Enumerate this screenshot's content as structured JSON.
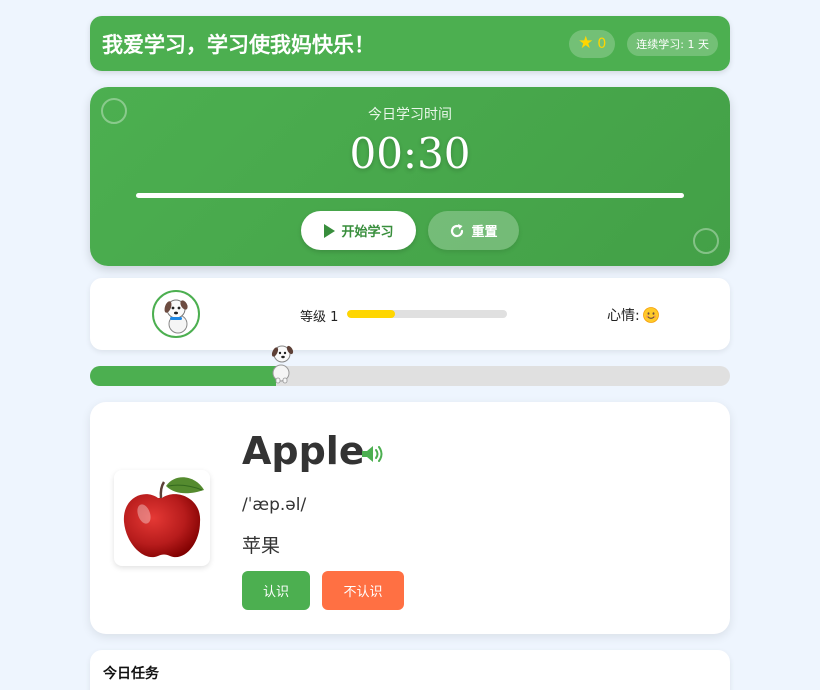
{
  "header": {
    "title": "我爱学习，学习使我妈快乐！",
    "stars": "0",
    "streak": "连续学习: 1 天"
  },
  "timer": {
    "label": "今日学习时间",
    "value": "00:30",
    "start_label": "开始学习",
    "reset_label": "重置",
    "bar_fraction": 1.0
  },
  "status": {
    "level_label": "等级 1",
    "level_progress": 0.3,
    "mood_label": "心情:",
    "mood_icon": "smile-face-icon"
  },
  "study_progress": 0.29,
  "word_card": {
    "word": "Apple",
    "phonetic": "/ˈæp.əl/",
    "meaning": "苹果",
    "know_label": "认识",
    "unknown_label": "不认识",
    "image": "apple-image"
  },
  "tasks": {
    "title": "今日任务"
  },
  "colors": {
    "primary": "#4caf50",
    "accent_orange": "#ff7043",
    "star": "#ffd600",
    "background": "#eef5fe"
  }
}
